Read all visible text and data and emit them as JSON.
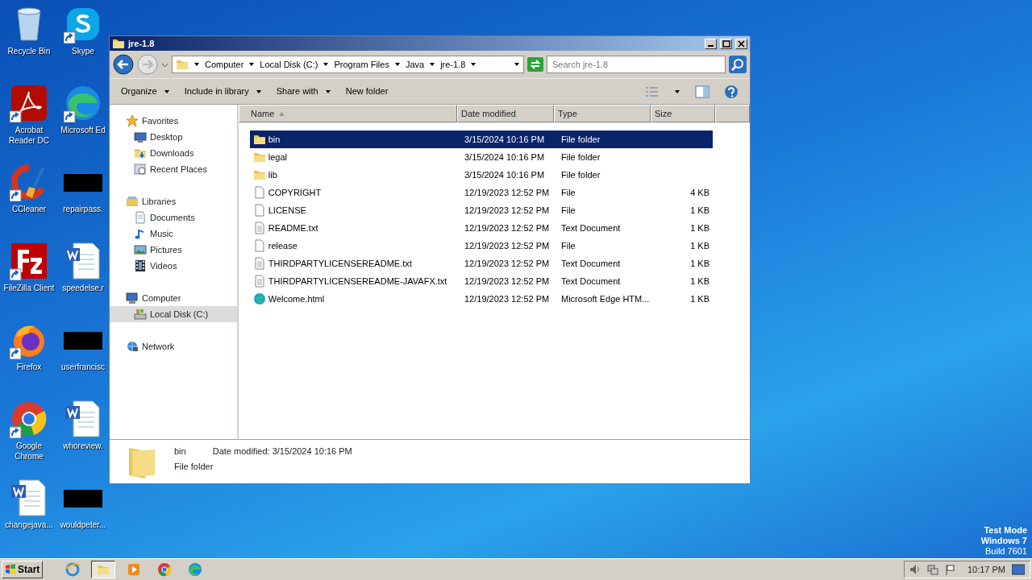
{
  "desktop_icons": [
    {
      "label": "Recycle Bin",
      "kind": "recycle-bin",
      "shortcut": false
    },
    {
      "label": "Skype",
      "kind": "skype",
      "shortcut": true
    },
    {
      "label": "Acrobat Reader DC",
      "kind": "acrobat",
      "shortcut": true
    },
    {
      "label": "Microsoft Ed",
      "kind": "edge",
      "shortcut": true
    },
    {
      "label": "CCleaner",
      "kind": "ccleaner",
      "shortcut": true
    },
    {
      "label": "repairpass.",
      "kind": "redacted",
      "shortcut": false
    },
    {
      "label": "FileZilla Client",
      "kind": "filezilla",
      "shortcut": true
    },
    {
      "label": "speedelse.r",
      "kind": "word",
      "shortcut": false
    },
    {
      "label": "Firefox",
      "kind": "firefox",
      "shortcut": true
    },
    {
      "label": "userfrancisc",
      "kind": "redacted",
      "shortcut": false
    },
    {
      "label": "Google Chrome",
      "kind": "chrome",
      "shortcut": true
    },
    {
      "label": "whoreview.",
      "kind": "word",
      "shortcut": false
    },
    {
      "label": "changejava...",
      "kind": "word",
      "shortcut": false
    },
    {
      "label": "wouldpeter...",
      "kind": "redacted",
      "shortcut": false
    }
  ],
  "window": {
    "title": "jre-1.8",
    "breadcrumb": [
      "Computer",
      "Local Disk (C:)",
      "Program Files",
      "Java",
      "jre-1.8"
    ],
    "search": {
      "placeholder": "Search jre-1.8"
    },
    "toolbar": [
      {
        "label": "Organize",
        "dropdown": true
      },
      {
        "label": "Include in library",
        "dropdown": true
      },
      {
        "label": "Share with",
        "dropdown": true
      },
      {
        "label": "New folder",
        "dropdown": false
      }
    ],
    "nav": [
      {
        "label": "Favorites",
        "kind": "star",
        "selected": false,
        "children": [
          {
            "label": "Desktop",
            "kind": "desktop",
            "selected": false
          },
          {
            "label": "Downloads",
            "kind": "downloads",
            "selected": false
          },
          {
            "label": "Recent Places",
            "kind": "recent",
            "selected": false
          }
        ]
      },
      {
        "label": "Libraries",
        "kind": "library",
        "selected": false,
        "children": [
          {
            "label": "Documents",
            "kind": "documents",
            "selected": false
          },
          {
            "label": "Music",
            "kind": "music",
            "selected": false
          },
          {
            "label": "Pictures",
            "kind": "pictures",
            "selected": false
          },
          {
            "label": "Videos",
            "kind": "videos",
            "selected": false
          }
        ]
      },
      {
        "label": "Computer",
        "kind": "computer",
        "selected": false,
        "children": [
          {
            "label": "Local Disk (C:)",
            "kind": "disk",
            "selected": true
          }
        ]
      },
      {
        "label": "Network",
        "kind": "network",
        "selected": false
      }
    ],
    "columns": [
      {
        "label": "Name",
        "sorted": true
      },
      {
        "label": "Date modified",
        "sorted": false
      },
      {
        "label": "Type",
        "sorted": false
      },
      {
        "label": "Size",
        "sorted": false
      }
    ],
    "files": [
      {
        "name": "bin",
        "date": "3/15/2024 10:16 PM",
        "type": "File folder",
        "kind": "folder",
        "selected": true
      },
      {
        "name": "legal",
        "date": "3/15/2024 10:16 PM",
        "type": "File folder",
        "kind": "folder",
        "selected": false
      },
      {
        "name": "lib",
        "date": "3/15/2024 10:16 PM",
        "type": "File folder",
        "kind": "folder",
        "selected": false
      },
      {
        "name": "COPYRIGHT",
        "date": "12/19/2023 12:52 PM",
        "type": "File",
        "size": "4 KB",
        "kind": "file",
        "selected": false
      },
      {
        "name": "LICENSE",
        "date": "12/19/2023 12:52 PM",
        "type": "File",
        "size": "1 KB",
        "kind": "file",
        "selected": false
      },
      {
        "name": "README.txt",
        "date": "12/19/2023 12:52 PM",
        "type": "Text Document",
        "size": "1 KB",
        "kind": "text",
        "selected": false
      },
      {
        "name": "release",
        "date": "12/19/2023 12:52 PM",
        "type": "File",
        "size": "1 KB",
        "kind": "file",
        "selected": false
      },
      {
        "name": "THIRDPARTYLICENSEREADME.txt",
        "date": "12/19/2023 12:52 PM",
        "type": "Text Document",
        "size": "1 KB",
        "kind": "text",
        "selected": false
      },
      {
        "name": "THIRDPARTYLICENSEREADME-JAVAFX.txt",
        "date": "12/19/2023 12:52 PM",
        "type": "Text Document",
        "size": "1 KB",
        "kind": "text",
        "selected": false
      },
      {
        "name": "Welcome.html",
        "date": "12/19/2023 12:52 PM",
        "type": "Microsoft Edge HTM...",
        "size": "1 KB",
        "kind": "edge",
        "selected": false
      }
    ],
    "details": {
      "name": "bin",
      "date_label": "Date modified:",
      "date": "3/15/2024 10:16 PM",
      "type": "File folder"
    }
  },
  "taskbar": {
    "start": "Start",
    "apps": [
      {
        "kind": "ie",
        "active": false
      },
      {
        "kind": "explorer",
        "active": true
      },
      {
        "kind": "media",
        "active": false
      },
      {
        "kind": "chrome",
        "active": false
      },
      {
        "kind": "edge",
        "active": false
      }
    ],
    "clock": "10:17 PM"
  },
  "os_notice": [
    "Test Mode",
    "Windows 7",
    "Build 7601"
  ]
}
